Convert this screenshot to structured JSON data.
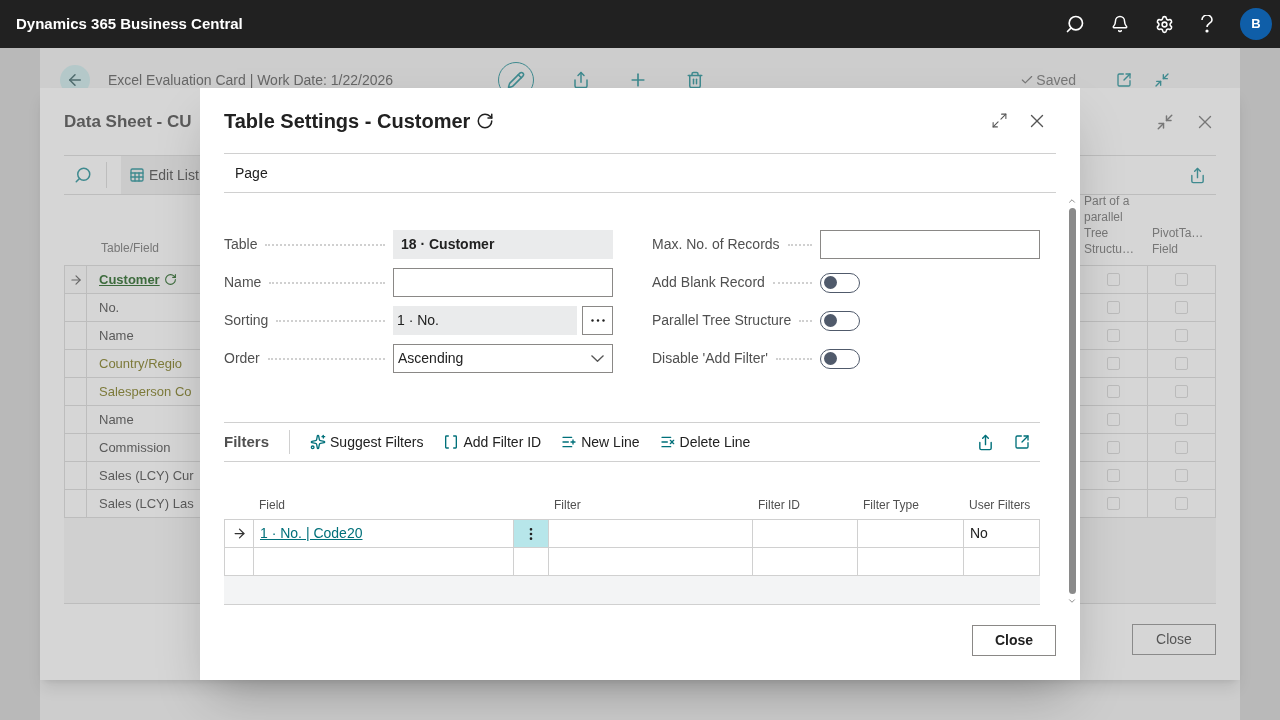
{
  "top_bar": {
    "title": "Dynamics 365 Business Central",
    "avatar": "B"
  },
  "card_page": {
    "title": "Excel Evaluation Card | Work Date: 1/22/2026",
    "status": "Saved"
  },
  "data_sheet": {
    "title": "Data Sheet - CU",
    "action": "Edit List",
    "column_header": "Table/Field",
    "rows": [
      {
        "label": "Customer",
        "kind": "table",
        "current": true
      },
      {
        "label": "No.",
        "kind": "field",
        "current": false
      },
      {
        "label": "Name",
        "kind": "field",
        "current": false
      },
      {
        "label": "Country/Regio",
        "kind": "related-table",
        "current": false
      },
      {
        "label": "Salesperson Co",
        "kind": "related-table",
        "current": false
      },
      {
        "label": "Name",
        "kind": "related-field",
        "current": false
      },
      {
        "label": "Commission",
        "kind": "related-field",
        "current": false
      },
      {
        "label": "Sales (LCY) Cur",
        "kind": "field",
        "current": false
      },
      {
        "label": "Sales (LCY) Las",
        "kind": "field",
        "current": false
      }
    ],
    "right_columns": [
      "Part of a parallel Tree Structu…",
      "PivotTa… Field"
    ],
    "check_rows": [
      [
        false,
        false
      ],
      [
        false,
        false
      ],
      [
        false,
        false
      ],
      [
        false,
        false
      ],
      [
        false,
        false
      ],
      [
        false,
        false
      ],
      [
        false,
        false
      ],
      [
        false,
        false
      ],
      [
        false,
        false
      ]
    ],
    "close_button": "Close"
  },
  "dialog": {
    "title": "Table Settings - Customer",
    "action_bar": [
      "Page"
    ],
    "left_fields": [
      {
        "label": "Table",
        "kind": "readonly",
        "value": "18 · Customer"
      },
      {
        "label": "Name",
        "kind": "text"
      },
      {
        "label": "Sorting",
        "kind": "lookup",
        "value": "1 · No."
      },
      {
        "label": "Order",
        "kind": "select",
        "value": "Ascending"
      }
    ],
    "right_fields": [
      {
        "label": "Max. No. of Records",
        "kind": "text"
      },
      {
        "label": "Add Blank Record",
        "kind": "toggle",
        "on": false
      },
      {
        "label": "Parallel Tree Structure",
        "kind": "toggle",
        "on": false
      },
      {
        "label": "Disable 'Add Filter'",
        "kind": "toggle",
        "on": false
      }
    ],
    "filters": {
      "title": "Filters",
      "actions": [
        {
          "label": "Suggest Filters",
          "kind": "suggest"
        },
        {
          "label": "Add Filter ID",
          "kind": "brackets"
        },
        {
          "label": "New Line",
          "kind": "new"
        },
        {
          "label": "Delete Line",
          "kind": "delete"
        }
      ],
      "columns": {
        "field": "Field",
        "filter": "Filter",
        "filter_id": "Filter ID",
        "filter_type": "Filter Type",
        "user_filters": "User Filters"
      },
      "rows": [
        {
          "field": "1 · No. | Code20",
          "user_filters": "No",
          "current": true
        },
        {
          "current": false
        }
      ]
    },
    "close_button": "Close"
  }
}
